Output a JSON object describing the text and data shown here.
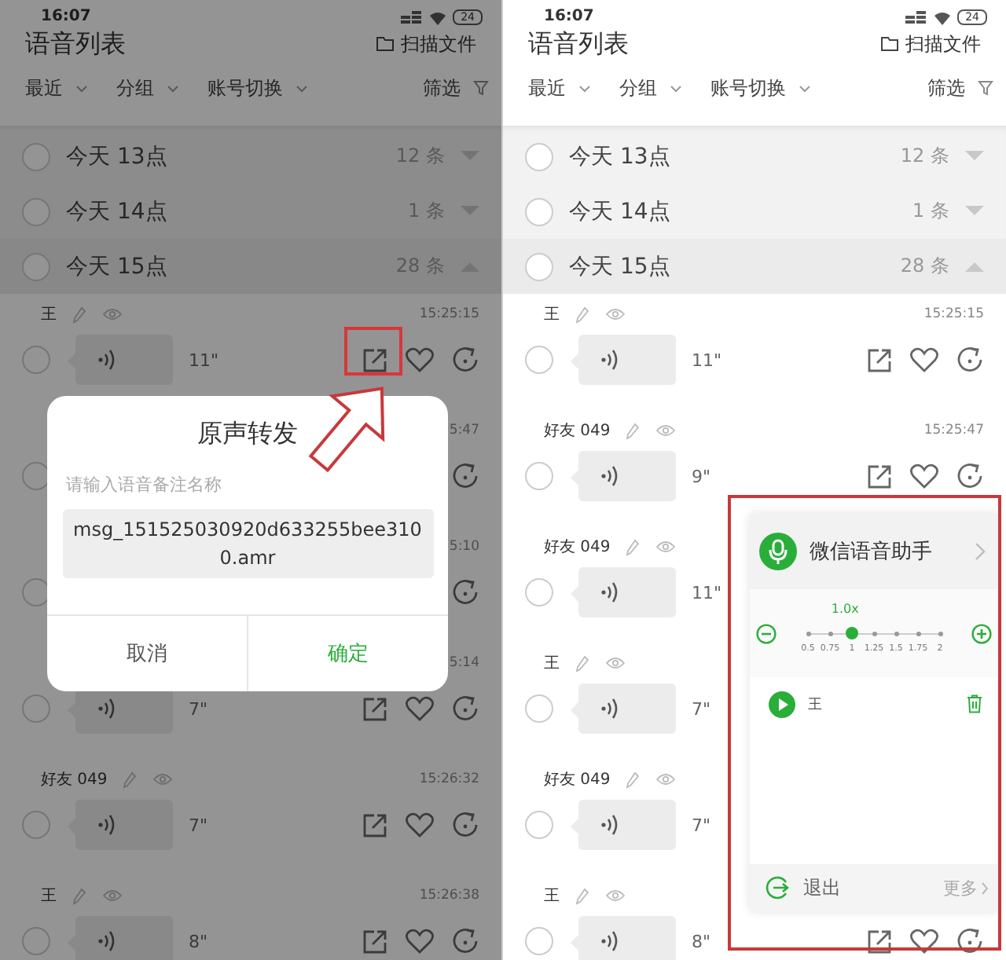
{
  "panels": [
    {
      "dimmed": true,
      "status_bar": {
        "time": "16:07",
        "battery": "24"
      },
      "title": "语音列表",
      "scan_label": "扫描文件",
      "filters": [
        "最近",
        "分组",
        "账号切换"
      ],
      "filter_label": "筛选",
      "groups": [
        {
          "label": "今天 13点",
          "count": "12 条",
          "expanded": false,
          "checked": false
        },
        {
          "label": "今天 14点",
          "count": "1 条",
          "expanded": false,
          "checked": false
        },
        {
          "label": "今天 15点",
          "count": "28 条",
          "expanded": true,
          "checked": false
        }
      ],
      "messages": [
        {
          "kind": "full",
          "name": "王",
          "time": "15:25:15",
          "duration": "11\"",
          "checked": false
        },
        {
          "kind": "partial",
          "time": "5:47",
          "checked": false
        },
        {
          "kind": "partial",
          "time": "5:10",
          "checked": false
        },
        {
          "kind": "full",
          "time": "5:14",
          "duration": "7\"",
          "checked": false
        },
        {
          "kind": "full",
          "name": "好友 049",
          "time": "15:26:32",
          "duration": "7\"",
          "checked": false
        },
        {
          "kind": "full",
          "name": "王",
          "time": "15:26:38",
          "duration": "8\"",
          "checked": false
        }
      ],
      "dialog": {
        "title": "原声转发",
        "label": "请输入语音备注名称",
        "value": "msg_151525030920d633255bee3100.amr",
        "buttons": [
          {
            "label": "取消",
            "kind": "cancel"
          },
          {
            "label": "确定",
            "kind": "confirm"
          }
        ]
      }
    },
    {
      "dimmed": false,
      "status_bar": {
        "time": "16:07",
        "battery": "24"
      },
      "title": "语音列表",
      "scan_label": "扫描文件",
      "filters": [
        "最近",
        "分组",
        "账号切换"
      ],
      "filter_label": "筛选",
      "groups": [
        {
          "label": "今天 13点",
          "count": "12 条",
          "expanded": false,
          "checked": false
        },
        {
          "label": "今天 14点",
          "count": "1 条",
          "expanded": false,
          "checked": false
        },
        {
          "label": "今天 15点",
          "count": "28 条",
          "expanded": true,
          "checked": false
        }
      ],
      "messages": [
        {
          "kind": "full",
          "name": "王",
          "time": "15:25:15",
          "duration": "11\"",
          "checked": false
        },
        {
          "kind": "full",
          "name": "好友 049",
          "time": "15:25:47",
          "duration": "9\"",
          "checked": false
        },
        {
          "kind": "bare",
          "name": "好友 049",
          "duration": "11\"",
          "checked": false
        },
        {
          "kind": "bare",
          "name": "王",
          "duration": "7\"",
          "checked": false
        },
        {
          "kind": "bare",
          "name": "好友 049",
          "duration": "7\"",
          "checked": false
        },
        {
          "kind": "full",
          "name": "王",
          "duration": "8\"",
          "checked": false
        }
      ],
      "assistant": {
        "title": "微信语音助手",
        "speed": {
          "reading": "1.0x",
          "labels": [
            "0.5",
            "0.75",
            "1",
            "1.25",
            "1.5",
            "1.75",
            "2"
          ],
          "level": 0.333
        },
        "player": {
          "name": "王"
        },
        "exit_label": "退出",
        "more_label": "更多"
      }
    }
  ]
}
